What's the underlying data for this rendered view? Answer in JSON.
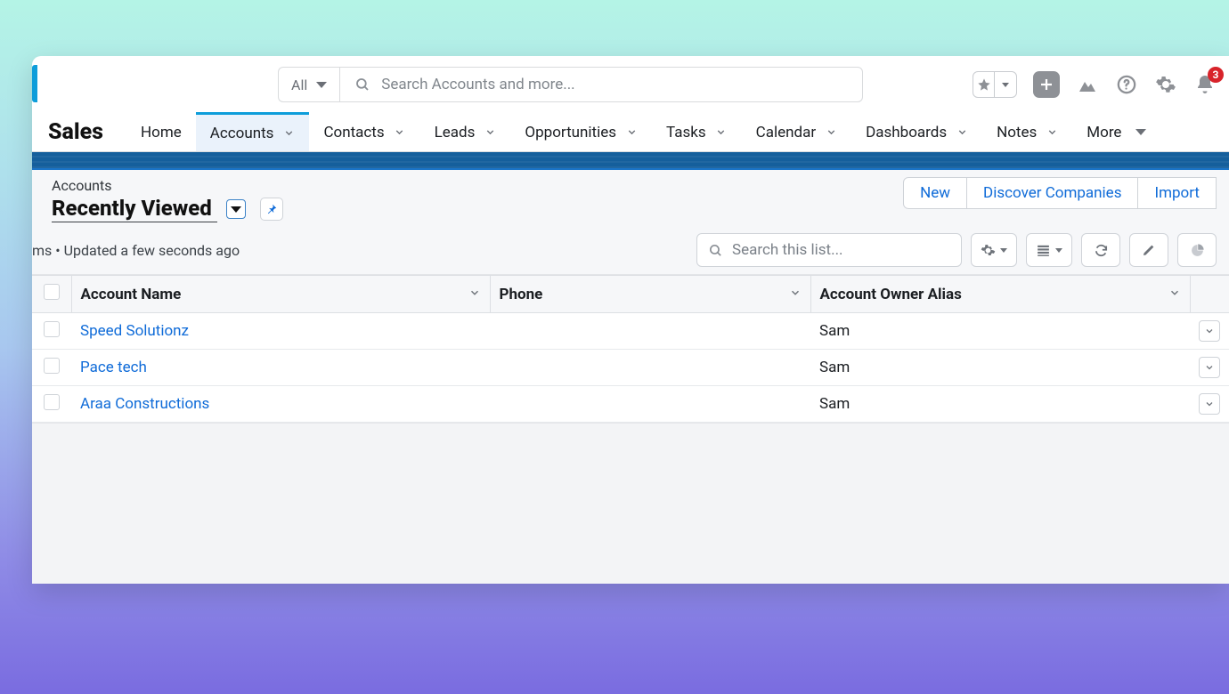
{
  "header": {
    "scope_label": "All",
    "search_placeholder": "Search Accounts and more...",
    "notification_count": "3"
  },
  "brand": "Sales",
  "nav": {
    "items": [
      {
        "label": "Home",
        "chevron": false,
        "active": false
      },
      {
        "label": "Accounts",
        "chevron": true,
        "active": true
      },
      {
        "label": "Contacts",
        "chevron": true,
        "active": false
      },
      {
        "label": "Leads",
        "chevron": true,
        "active": false
      },
      {
        "label": "Opportunities",
        "chevron": true,
        "active": false
      },
      {
        "label": "Tasks",
        "chevron": true,
        "active": false
      },
      {
        "label": "Calendar",
        "chevron": true,
        "active": false
      },
      {
        "label": "Dashboards",
        "chevron": true,
        "active": false
      },
      {
        "label": "Notes",
        "chevron": true,
        "active": false
      }
    ],
    "more_label": "More"
  },
  "page": {
    "object_label": "Accounts",
    "view_name": "Recently Viewed",
    "meta_suffix": "ms • Updated a few seconds ago",
    "actions": [
      {
        "label": "New"
      },
      {
        "label": "Discover Companies"
      },
      {
        "label": "Import"
      }
    ],
    "list_search_placeholder": "Search this list..."
  },
  "table": {
    "columns": [
      {
        "label": "Account Name"
      },
      {
        "label": "Phone"
      },
      {
        "label": "Account Owner Alias"
      }
    ],
    "rows": [
      {
        "name": "Speed Solutionz",
        "phone": "",
        "owner": "Sam"
      },
      {
        "name": "Pace tech",
        "phone": "",
        "owner": "Sam"
      },
      {
        "name": "Araa Constructions",
        "phone": "",
        "owner": "Sam"
      }
    ]
  }
}
